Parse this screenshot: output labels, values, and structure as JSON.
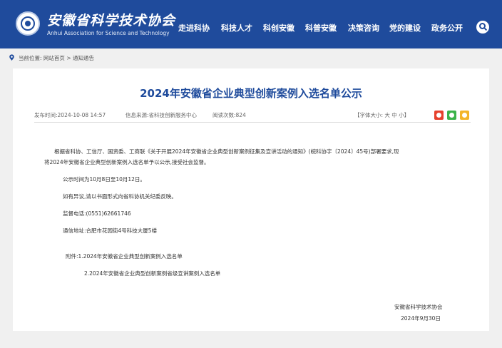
{
  "header": {
    "logo_cn": "安徽省科学技术协会",
    "logo_en": "Anhui Association for Science and Technology",
    "nav": [
      "走进科协",
      "科技人才",
      "科创安徽",
      "科普安徽",
      "决策咨询",
      "党的建设",
      "政务公开"
    ],
    "colors": {
      "bar": "#1f4b9c",
      "title": "#1f4b9c"
    }
  },
  "breadcrumb": {
    "label": "当前位置:",
    "home": "网站首页",
    "sep": ">",
    "current": "通知通告"
  },
  "article": {
    "title": "2024年安徽省企业典型创新案例入选名单公示",
    "date": "发布时间:2024-10-08 14:57",
    "source": "信息来源:省科技创新服务中心",
    "views": "阅读次数:824",
    "fontsize": "【字体大小: 大 中 小】",
    "share_icons": [
      "weibo-icon",
      "wechat-icon",
      "qzone-icon"
    ],
    "share_colors": [
      "#e6412d",
      "#3bb34a",
      "#f3b52a"
    ],
    "paragraphs": {
      "intro_1": "根据省科协、工信厅、国资委、工商联《关于开展2024年安徽省企业典型创新案例征集及宣讲活动的通知》(皖科协字〔2024〕45号)部署要求,现",
      "intro_2": "将2024年安徽省企业典型创新案例入选名单予以公示,接受社会监督。",
      "period": "公示时间为10月8日至10月12日。",
      "objection": "如有异议,请以书面形式向省科协机关纪委反映。",
      "phone": "监督电话:(0551)62661746",
      "address": "通信地址:合肥市花园街4号科技大厦5楼",
      "att_1": "附件:1.2024年安徽省企业典型创新案例入选名单",
      "att_2": "2.2024年安徽省企业典型创新案例省级宣讲案例入选名单"
    },
    "signature": {
      "org": "安徽省科学技术协会",
      "date": "2024年9月30日"
    }
  }
}
